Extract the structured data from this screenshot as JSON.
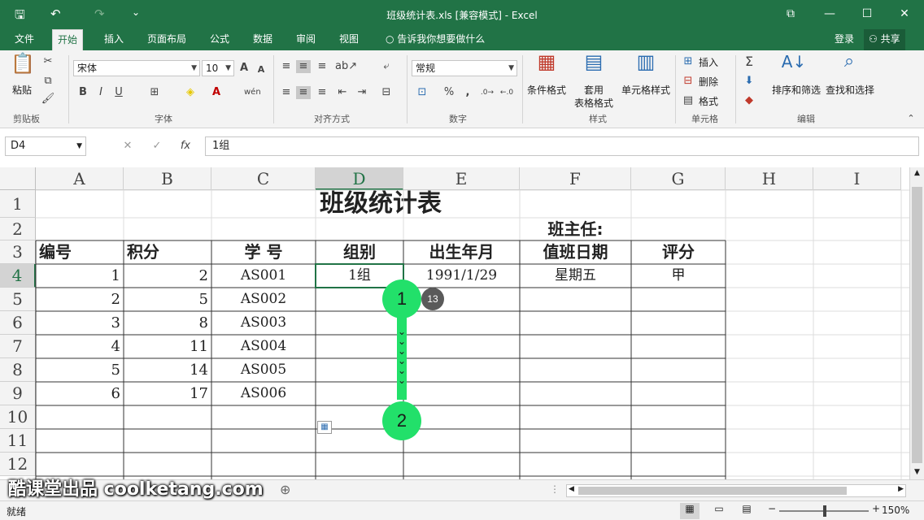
{
  "window": {
    "title": "班级统计表.xls  [兼容模式] - Excel",
    "quick_access": {
      "save": "🖫",
      "undo": "↶",
      "redo": "↷",
      "customize": "⌄"
    },
    "controls": {
      "ribbon_display": "⧉",
      "minimize": "—",
      "maximize": "☐",
      "close": "✕"
    }
  },
  "tabs": [
    {
      "label": "文件",
      "active": false
    },
    {
      "label": "开始",
      "active": true
    },
    {
      "label": "插入",
      "active": false
    },
    {
      "label": "页面布局",
      "active": false
    },
    {
      "label": "公式",
      "active": false
    },
    {
      "label": "数据",
      "active": false
    },
    {
      "label": "审阅",
      "active": false
    },
    {
      "label": "视图",
      "active": false
    }
  ],
  "tell_me": "告诉我你想要做什么",
  "account": {
    "login": "登录",
    "share": "共享"
  },
  "ribbon": {
    "clipboard": {
      "label": "剪贴板",
      "paste": "粘贴"
    },
    "font": {
      "label": "字体",
      "font_name": "宋体",
      "font_size": "10",
      "bold": "B",
      "italic": "I",
      "underline": "U",
      "grow": "A",
      "shrink": "A",
      "phonetic": "wén"
    },
    "alignment": {
      "label": "对齐方式"
    },
    "number": {
      "label": "数字",
      "format": "常规",
      "percent": "%",
      "comma": ","
    },
    "styles": {
      "label": "样式",
      "conditional": "条件格式",
      "table1": "套用",
      "table2": "表格格式",
      "cell_styles": "单元格样式"
    },
    "cells": {
      "label": "单元格",
      "insert": "插入",
      "delete": "删除",
      "format": "格式"
    },
    "editing": {
      "label": "编辑",
      "sort": "排序和筛选",
      "find": "查找和选择"
    }
  },
  "formula_bar": {
    "name_box": "D4",
    "fx": "fx",
    "cancel": "✕",
    "enter": "✓",
    "value": "1组"
  },
  "columns": [
    "A",
    "B",
    "C",
    "D",
    "E",
    "F",
    "G",
    "H",
    "I"
  ],
  "rows": [
    "1",
    "2",
    "3",
    "4",
    "5",
    "6",
    "7",
    "8",
    "9",
    "10",
    "11",
    "12"
  ],
  "sheet": {
    "title": "班级统计表",
    "teacher_label": "班主任:",
    "headers": {
      "A": "编号",
      "B": "积分",
      "C": "学   号",
      "D": "组别",
      "E": "出生年月",
      "F": "值班日期",
      "G": "评分"
    },
    "data": [
      {
        "A": "1",
        "B": "2",
        "C": "AS001",
        "D": "1组",
        "E": "1991/1/29",
        "F": "星期五",
        "G": "甲"
      },
      {
        "A": "2",
        "B": "5",
        "C": "AS002"
      },
      {
        "A": "3",
        "B": "8",
        "C": "AS003"
      },
      {
        "A": "4",
        "B": "11",
        "C": "AS004"
      },
      {
        "A": "5",
        "B": "14",
        "C": "AS005"
      },
      {
        "A": "6",
        "B": "17",
        "C": "AS006"
      }
    ]
  },
  "overlay": {
    "marker_1": "1",
    "marker_2": "2",
    "badge": "13"
  },
  "watermark": "酷课堂出品 coolketang.com",
  "status": {
    "ready": "就绪",
    "zoom": "150%"
  },
  "colors": {
    "excel_green": "#217346",
    "marker_green": "#22e06a"
  }
}
